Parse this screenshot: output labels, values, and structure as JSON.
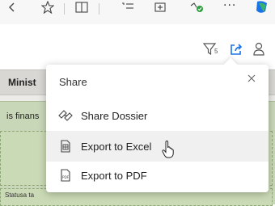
{
  "browser_toolbar": {
    "icons": [
      "back-icon",
      "favorites-icon",
      "split-screen-icon",
      "favorites-list-icon",
      "collections-icon",
      "extensions-icon",
      "more-icon",
      "copilot-icon"
    ],
    "more_label": "···"
  },
  "app_bar": {
    "icons": [
      "filter-icon",
      "share-icon",
      "user-icon"
    ],
    "filter_badge": "5"
  },
  "background": {
    "table_header": "Minist",
    "row_text": "is finans",
    "bottom_text": "Statusa ta"
  },
  "share_popup": {
    "title": "Share",
    "items": [
      {
        "label": "Share Dossier",
        "icon": "share-dossier-icon"
      },
      {
        "label": "Export to Excel",
        "icon": "excel-icon",
        "hovered": true
      },
      {
        "label": "Export to PDF",
        "icon": "pdf-icon"
      }
    ]
  },
  "colors": {
    "accent": "#1a73e8",
    "panel_green": "#c9d7b9",
    "header_gray": "#d8d7d3",
    "hover_gray": "#f0f0f0"
  }
}
